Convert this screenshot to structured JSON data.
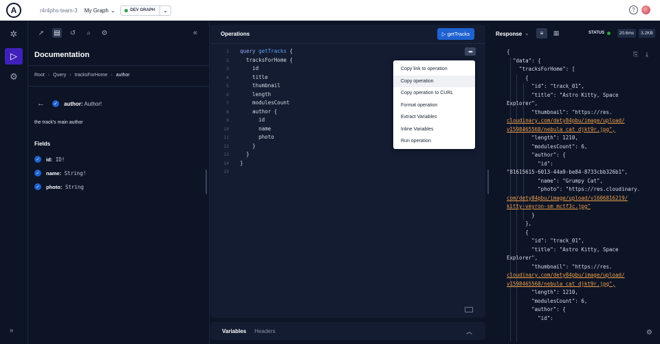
{
  "header": {
    "org": "r4r4phs-team-3",
    "graph": "My Graph",
    "variant": "DEV GRAPH",
    "logo_letter": "A"
  },
  "rail": {
    "items": [
      {
        "name": "schema-icon"
      },
      {
        "name": "explorer-icon"
      },
      {
        "name": "settings-icon"
      }
    ]
  },
  "docs": {
    "title": "Documentation",
    "breadcrumbs": [
      "Root",
      "Query",
      "tracksForHome",
      "author"
    ],
    "field_name": "author:",
    "field_type": "Author!",
    "description": "the track's main author",
    "fields_title": "Fields",
    "fields": [
      {
        "name": "id:",
        "type": "ID!"
      },
      {
        "name": "name:",
        "type": "String!"
      },
      {
        "name": "photo:",
        "type": "String"
      }
    ]
  },
  "operations": {
    "title": "Operations",
    "run_label": "getTracks",
    "lines": [
      "1",
      "2",
      "3",
      "4",
      "5",
      "6",
      "7",
      "8",
      "9",
      "10",
      "11",
      "12",
      "13",
      "14",
      "15"
    ],
    "menu": [
      "Copy link to operation",
      "Copy operation",
      "Copy operation to CURL",
      "Format operation",
      "Extract Variables",
      "Inline Variables",
      "Run operation"
    ]
  },
  "variables": {
    "tab_variables": "Variables",
    "tab_headers": "Headers"
  },
  "response": {
    "title": "Response",
    "status_label": "STATUS",
    "time": "20.6ms",
    "size": "3.2KB",
    "lines": [
      "{",
      "  \"data\": {",
      "    \"tracksForHome\": [",
      "      {",
      "        \"id\": \"track_01\",",
      "        \"title\": \"Astro Kitty, Space",
      "Explorer\",",
      "        \"thumbnail\": \"https://res.",
      "cloudinary.com/dety84pbu/image/upload/",
      "v1598465568/nebula_cat_djkt9r.jpg\",",
      "        \"length\": 1210,",
      "        \"modulesCount\": 6,",
      "        \"author\": {",
      "          \"id\":",
      "\"81615615-6013-44a9-be84-8733cbb326b1\",",
      "          \"name\": \"Grumpy Cat\",",
      "          \"photo\": \"https://res.cloudinary.",
      "com/dety84pbu/image/upload/v1606816219/",
      "kitty-veyron-sm_mctf3c.jpg\"",
      "        }",
      "      },",
      "      {",
      "        \"id\": \"track_01\",",
      "        \"title\": \"Astro Kitty, Space",
      "Explorer\",",
      "        \"thumbnail\": \"https://res.",
      "cloudinary.com/dety84pbu/image/upload/",
      "v1598465568/nebula_cat_djkt9r.jpg\",",
      "        \"length\": 1210,",
      "        \"modulesCount\": 6,",
      "        \"author\": {",
      "          \"id\":"
    ]
  }
}
